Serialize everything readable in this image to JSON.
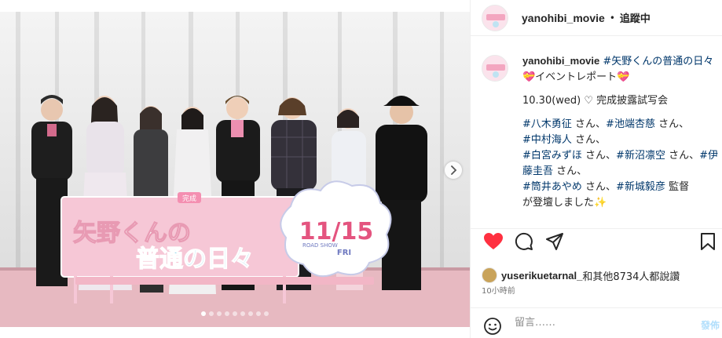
{
  "post": {
    "username": "yanohibi_movie",
    "follow_separator": "•",
    "follow_status": "追蹤中"
  },
  "photo": {
    "banner_line1": "矢野くんの",
    "banner_line2": "普通の日々",
    "banner_badge": "完成",
    "date_number": "11/15",
    "date_day": "FRI",
    "road_show": "ROAD SHOW",
    "slide_count": 9,
    "active_slide": 0
  },
  "caption": {
    "username": "yanohibi_movie",
    "hashtag_title": "#矢野くんの普通の日々",
    "event_line": "💝イベントレポート💝",
    "date_line": "10.30(wed) ♡ 完成披露試写会",
    "tag1": "#八木勇征",
    "text1": " さん、",
    "tag2": "#池端杏慈",
    "text2": " さん、",
    "tag3": "#中村海人",
    "text3": " さん、",
    "tag4": "#白宮みずほ",
    "text4": " さん、",
    "tag5": "#新沼凛空",
    "text5": " さん、",
    "tag6": "#伊藤圭吾",
    "text6": " さん、",
    "tag7": "#筒井あやめ",
    "text7": " さん、",
    "tag8": "#新城毅彦",
    "text8": " 監督",
    "closing": "が登壇しました✨"
  },
  "likes": {
    "user": "yuserikuetarnal_",
    "text": "和其他8734人都說讚"
  },
  "time_ago": "10小時前",
  "comment": {
    "placeholder": "留言……",
    "post_label": "發佈"
  },
  "colors": {
    "like_red": "#ff3040",
    "link_blue": "#00376b",
    "banner_pink": "#f6c7d6",
    "stage_floor": "#e7b9c1"
  }
}
